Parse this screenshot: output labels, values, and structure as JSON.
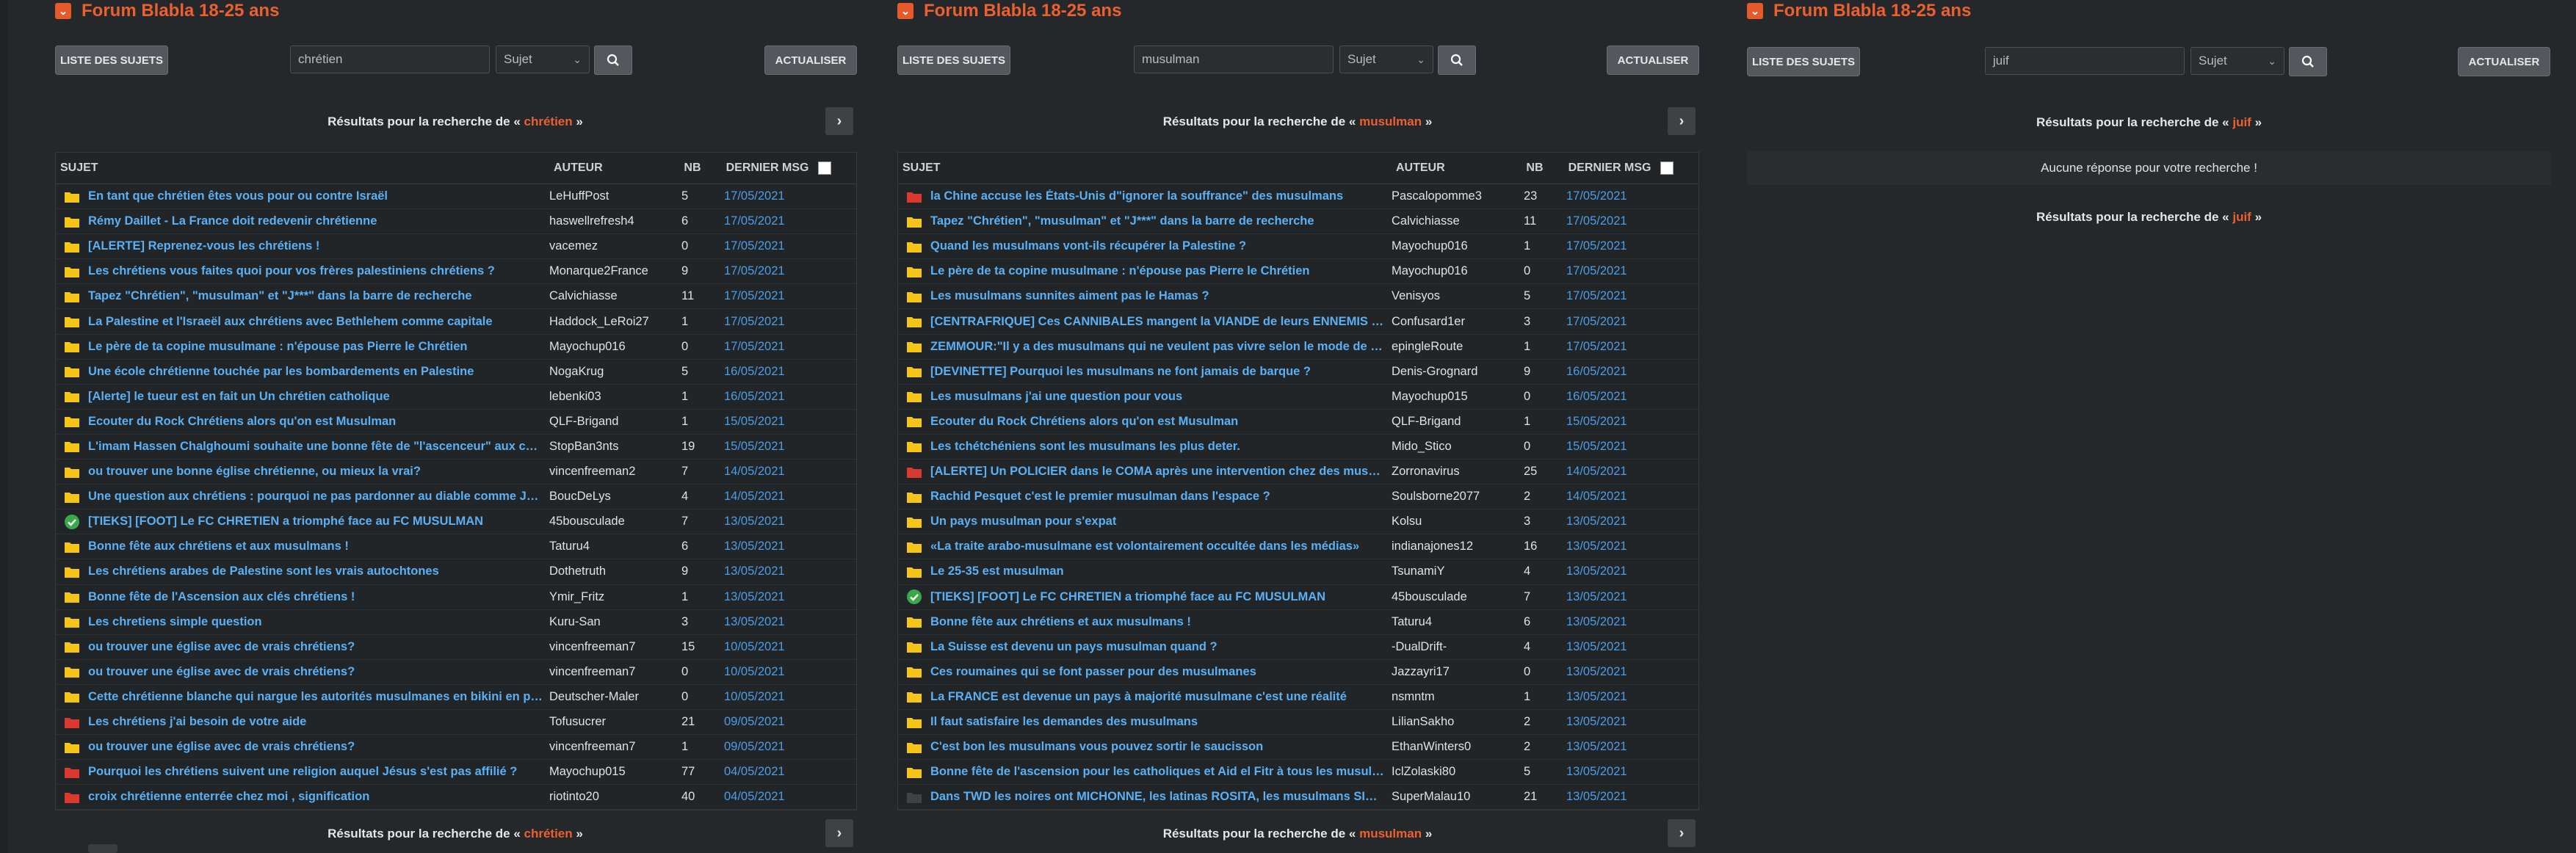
{
  "panels": [
    {
      "title": "Forum Blabla 18-25 ans",
      "list_btn": "LISTE DES SUJETS",
      "search_value": "chrétien",
      "select_value": "Sujet",
      "refresh_btn": "ACTUALISER",
      "results_prefix": "Résultats pour la recherche de «",
      "results_query": "chrétien",
      "results_suffix": "»",
      "headers": {
        "subject": "SUJET",
        "author": "AUTEUR",
        "nb": "NB",
        "last": "DERNIER MSG"
      },
      "rows": [
        {
          "icon": "folder",
          "subject": "En tant que chrétien êtes vous pour ou contre Israël",
          "author": "LeHuffPost",
          "nb": "5",
          "date": "17/05/2021"
        },
        {
          "icon": "folder",
          "subject": "Rémy Daillet - La France doit redevenir chrétienne",
          "author": "haswellrefresh4",
          "nb": "6",
          "date": "17/05/2021"
        },
        {
          "icon": "folder",
          "subject": "[ALERTE] Reprenez-vous les chrétiens !",
          "author": "vacemez",
          "nb": "0",
          "date": "17/05/2021"
        },
        {
          "icon": "folder",
          "subject": "Les chrétiens vous faites quoi pour vos frères palestiniens chrétiens ?",
          "author": "Monarque2France",
          "nb": "9",
          "date": "17/05/2021"
        },
        {
          "icon": "folder",
          "subject": "Tapez \"Chrétien\", \"musulman\" et \"J***\" dans la barre de recherche",
          "author": "Calvichiasse",
          "nb": "11",
          "date": "17/05/2021"
        },
        {
          "icon": "folder",
          "subject": "La Palestine et l'Israeël aux chrétiens avec Bethlehem comme capitale",
          "author": "Haddock_LeRoi27",
          "nb": "1",
          "date": "17/05/2021"
        },
        {
          "icon": "folder",
          "subject": "Le père de ta copine musulmane : n'épouse pas Pierre le Chrétien",
          "author": "Mayochup016",
          "nb": "0",
          "date": "17/05/2021"
        },
        {
          "icon": "folder",
          "subject": "Une école chrétienne touchée par les bombardements en Palestine",
          "author": "NogaKrug",
          "nb": "5",
          "date": "16/05/2021"
        },
        {
          "icon": "folder",
          "subject": "[Alerte] le tueur est en fait un Un chrétien catholique",
          "author": "lebenki03",
          "nb": "1",
          "date": "16/05/2021"
        },
        {
          "icon": "folder",
          "subject": "Ecouter du Rock Chrétiens alors qu'on est Musulman",
          "author": "QLF-Brigand",
          "nb": "1",
          "date": "15/05/2021"
        },
        {
          "icon": "folder",
          "subject": "L'imam Hassen Chalghoumi souhaite une bonne fête de \"l'ascenceur\" aux chrétiens",
          "author": "StopBan3nts",
          "nb": "19",
          "date": "15/05/2021"
        },
        {
          "icon": "folder",
          "subject": "ou trouver une bonne église chrétienne, ou mieux la vrai?",
          "author": "vincenfreeman2",
          "nb": "7",
          "date": "14/05/2021"
        },
        {
          "icon": "folder",
          "subject": "Une question aux chrétiens : pourquoi ne pas pardonner au diable comme Jésus l'a fait ?",
          "author": "BoucDeLys",
          "nb": "4",
          "date": "14/05/2021"
        },
        {
          "icon": "check",
          "subject": "[TIEKS] [FOOT] Le FC CHRETIEN a triomphé face au FC MUSULMAN",
          "author": "45bousculade",
          "nb": "7",
          "date": "13/05/2021"
        },
        {
          "icon": "folder",
          "subject": "Bonne fête aux chrétiens et aux musulmans !",
          "author": "Taturu4",
          "nb": "6",
          "date": "13/05/2021"
        },
        {
          "icon": "folder",
          "subject": "Les chrétiens arabes de Palestine sont les vrais autochtones",
          "author": "Dothetruth",
          "nb": "9",
          "date": "13/05/2021"
        },
        {
          "icon": "folder",
          "subject": "Bonne fête de l'Ascension aux clés chrétiens !",
          "author": "Ymir_Fritz",
          "nb": "1",
          "date": "13/05/2021"
        },
        {
          "icon": "folder",
          "subject": "Les chretiens simple question",
          "author": "Kuru-San",
          "nb": "3",
          "date": "13/05/2021"
        },
        {
          "icon": "folder",
          "subject": "ou trouver une église avec de vrais chrétiens?",
          "author": "vincenfreeman7",
          "nb": "15",
          "date": "10/05/2021"
        },
        {
          "icon": "folder",
          "subject": "ou trouver une église avec de vrais chrétiens?",
          "author": "vincenfreeman7",
          "nb": "0",
          "date": "10/05/2021"
        },
        {
          "icon": "folder",
          "subject": "Cette chrétienne blanche qui nargue les autorités musulmanes en bikini en plein ramadan",
          "author": "Deutscher-Maler",
          "nb": "0",
          "date": "10/05/2021"
        },
        {
          "icon": "folder-red",
          "subject": "Les chrétiens j'ai besoin de votre aide",
          "author": "Tofusucrer",
          "nb": "21",
          "date": "09/05/2021"
        },
        {
          "icon": "folder",
          "subject": "ou trouver une église avec de vrais chrétiens?",
          "author": "vincenfreeman7",
          "nb": "1",
          "date": "09/05/2021"
        },
        {
          "icon": "folder-red",
          "subject": "Pourquoi les chrétiens suivent une religion auquel Jésus s'est pas affilié ?",
          "author": "Mayochup015",
          "nb": "77",
          "date": "04/05/2021"
        },
        {
          "icon": "folder-red",
          "subject": "croix chrétienne enterrée chez moi , signification",
          "author": "riotinto20",
          "nb": "40",
          "date": "04/05/2021"
        }
      ]
    },
    {
      "title": "Forum Blabla 18-25 ans",
      "list_btn": "LISTE DES SUJETS",
      "search_value": "musulman",
      "select_value": "Sujet",
      "refresh_btn": "ACTUALISER",
      "results_prefix": "Résultats pour la recherche de «",
      "results_query": "musulman",
      "results_suffix": "»",
      "headers": {
        "subject": "SUJET",
        "author": "AUTEUR",
        "nb": "NB",
        "last": "DERNIER MSG"
      },
      "rows": [
        {
          "icon": "folder-red",
          "subject": "la Chine accuse les États-Unis d\"ignorer la souffrance\" des musulmans",
          "author": "Pascalopomme3",
          "nb": "23",
          "date": "17/05/2021"
        },
        {
          "icon": "folder",
          "subject": "Tapez \"Chrétien\", \"musulman\" et \"J***\" dans la barre de recherche",
          "author": "Calvichiasse",
          "nb": "11",
          "date": "17/05/2021"
        },
        {
          "icon": "folder",
          "subject": "Quand les musulmans vont-ils récupérer la Palestine ?",
          "author": "Mayochup016",
          "nb": "1",
          "date": "17/05/2021"
        },
        {
          "icon": "folder",
          "subject": "Le père de ta copine musulmane : n'épouse pas Pierre le Chrétien",
          "author": "Mayochup016",
          "nb": "0",
          "date": "17/05/2021"
        },
        {
          "icon": "folder",
          "subject": "Les musulmans sunnites aiment pas le Hamas ?",
          "author": "Venisyos",
          "nb": "5",
          "date": "17/05/2021"
        },
        {
          "icon": "folder",
          "subject": "[CENTRAFRIQUE] Ces CANNIBALES mangent la VIANDE de leurs ENNEMIS MUSULMANS",
          "author": "Confusard1er",
          "nb": "3",
          "date": "17/05/2021"
        },
        {
          "icon": "folder",
          "subject": "ZEMMOUR:\"Il y a des musulmans qui ne veulent pas vivre selon le mode de vie français\"",
          "author": "epingleRoute",
          "nb": "1",
          "date": "17/05/2021"
        },
        {
          "icon": "folder",
          "subject": "[DEVINETTE] Pourquoi les musulmans ne font jamais de barque ?",
          "author": "Denis-Grognard",
          "nb": "9",
          "date": "16/05/2021"
        },
        {
          "icon": "folder",
          "subject": "Les musulmans j'ai une question pour vous",
          "author": "Mayochup015",
          "nb": "0",
          "date": "16/05/2021"
        },
        {
          "icon": "folder",
          "subject": "Ecouter du Rock Chrétiens alors qu'on est Musulman",
          "author": "QLF-Brigand",
          "nb": "1",
          "date": "15/05/2021"
        },
        {
          "icon": "folder",
          "subject": "Les tchétchéniens sont les musulmans les plus deter.",
          "author": "Mido_Stico",
          "nb": "0",
          "date": "15/05/2021"
        },
        {
          "icon": "folder-red",
          "subject": "[ALERTE] Un POLICIER dans le COMA après une intervention chez des musulmans",
          "author": "Zorronavirus",
          "nb": "25",
          "date": "14/05/2021"
        },
        {
          "icon": "folder",
          "subject": "Rachid Pesquet c'est le premier musulman dans l'espace ?",
          "author": "Soulsborne2077",
          "nb": "2",
          "date": "14/05/2021"
        },
        {
          "icon": "folder",
          "subject": "Un pays musulman pour s'expat",
          "author": "Kolsu",
          "nb": "3",
          "date": "13/05/2021"
        },
        {
          "icon": "folder",
          "subject": "«La traite arabo-musulmane est volontairement occultée dans les médias»",
          "author": "indianajones12",
          "nb": "16",
          "date": "13/05/2021"
        },
        {
          "icon": "folder",
          "subject": "Le 25-35 est musulman",
          "author": "TsunamiY",
          "nb": "4",
          "date": "13/05/2021"
        },
        {
          "icon": "check",
          "subject": "[TIEKS] [FOOT] Le FC CHRETIEN a triomphé face au FC MUSULMAN",
          "author": "45bousculade",
          "nb": "7",
          "date": "13/05/2021"
        },
        {
          "icon": "folder",
          "subject": "Bonne fête aux chrétiens et aux musulmans !",
          "author": "Taturu4",
          "nb": "6",
          "date": "13/05/2021"
        },
        {
          "icon": "folder",
          "subject": "La Suisse est devenu un pays musulman quand ?",
          "author": "-DualDrift-",
          "nb": "4",
          "date": "13/05/2021"
        },
        {
          "icon": "folder",
          "subject": "Ces roumaines qui se font passer pour des musulmanes",
          "author": "Jazzayri17",
          "nb": "0",
          "date": "13/05/2021"
        },
        {
          "icon": "folder",
          "subject": "La FRANCE est devenue un pays à majorité musulmane c'est une réalité",
          "author": "nsmntm",
          "nb": "1",
          "date": "13/05/2021"
        },
        {
          "icon": "folder",
          "subject": "Il faut satisfaire les demandes des musulmans",
          "author": "LilianSakho",
          "nb": "2",
          "date": "13/05/2021"
        },
        {
          "icon": "folder",
          "subject": "C'est bon les musulmans vous pouvez sortir le saucisson",
          "author": "EthanWinters0",
          "nb": "2",
          "date": "13/05/2021"
        },
        {
          "icon": "folder",
          "subject": "Bonne fête de l'ascension pour les catholiques et Aid el Fitr à tous les musulmans",
          "author": "IclZolaski80",
          "nb": "5",
          "date": "13/05/2021"
        },
        {
          "icon": "folder-gray",
          "subject": "Dans TWD les noires ont MICHONNE, les latinas ROSITA, les musulmans SIDDIQ",
          "author": "SuperMalau10",
          "nb": "21",
          "date": "13/05/2021"
        }
      ]
    },
    {
      "title": "Forum Blabla 18-25 ans",
      "list_btn": "LISTE DES SUJETS",
      "search_value": "juif",
      "select_value": "Sujet",
      "refresh_btn": "ACTUALISER",
      "results_prefix": "Résultats pour la recherche de «",
      "results_query": "juif",
      "results_suffix": "»",
      "no_response": "Aucune réponse pour votre recherche !"
    }
  ],
  "colors": {
    "background": "#25282b",
    "accent": "#ec5f2f",
    "link": "#5ab0f2",
    "date": "#4d9de6",
    "folder": "#f5c518",
    "folder_red": "#d9392f",
    "check": "#3aa84a"
  }
}
